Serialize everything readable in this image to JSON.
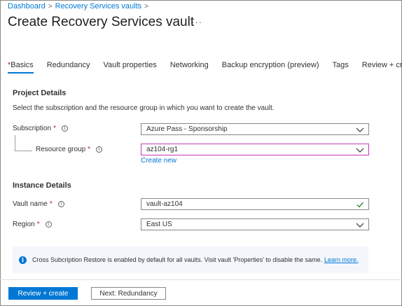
{
  "breadcrumb": {
    "items": [
      "Dashboard",
      "Recovery Services vaults"
    ]
  },
  "page": {
    "title": "Create Recovery Services vault",
    "more": "···"
  },
  "tabs": [
    {
      "label": "Basics",
      "required": true,
      "active": true
    },
    {
      "label": "Redundancy"
    },
    {
      "label": "Vault properties"
    },
    {
      "label": "Networking"
    },
    {
      "label": "Backup encryption (preview)"
    },
    {
      "label": "Tags"
    },
    {
      "label": "Review + create"
    }
  ],
  "project": {
    "heading": "Project Details",
    "description": "Select the subscription and the resource group in which you want to create the vault.",
    "subscription": {
      "label": "Subscription",
      "value": "Azure Pass - Sponsorship"
    },
    "resource_group": {
      "label": "Resource group",
      "value": "az104-rg1",
      "create_new": "Create new"
    }
  },
  "instance": {
    "heading": "Instance Details",
    "vault_name": {
      "label": "Vault name",
      "value": "vault-az104"
    },
    "region": {
      "label": "Region",
      "value": "East US"
    }
  },
  "banner": {
    "text": "Cross Subcription Restore is enabled by default for all vaults. Visit vault 'Properties' to disable the same.",
    "link": "Learn more."
  },
  "footer": {
    "primary": "Review + create",
    "secondary": "Next: Redundancy"
  },
  "colors": {
    "accent": "#0078d4",
    "required": "#a4262c",
    "success": "#107c10",
    "focus": "#c239b3"
  }
}
